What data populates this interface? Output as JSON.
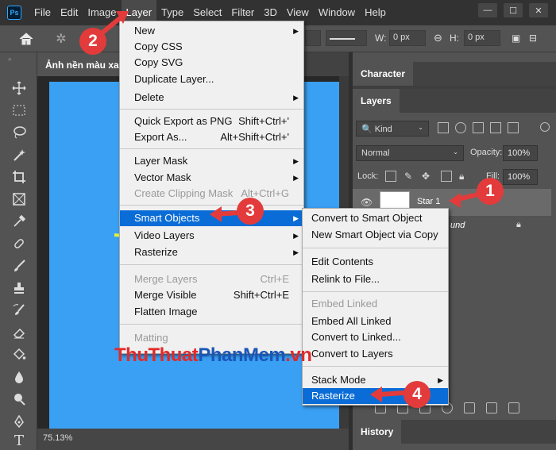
{
  "app": {
    "logo": "Ps"
  },
  "menubar": {
    "items": [
      "File",
      "Edit",
      "Image",
      "Layer",
      "Type",
      "Select",
      "Filter",
      "3D",
      "View",
      "Window",
      "Help"
    ],
    "active": "Layer"
  },
  "options_bar": {
    "w_label": "W:",
    "w_value": "0 px",
    "h_label": "H:",
    "h_value": "0 px",
    "link_icon": "link-icon"
  },
  "document": {
    "tab_title": "Ảnh nền màu xa",
    "zoom": "75.13%"
  },
  "panels": {
    "character_tab": "Character",
    "layers_tab": "Layers",
    "history_tab": "History",
    "filter_kind": "Kind",
    "blend_mode": "Normal",
    "opacity_label": "Opacity:",
    "opacity_value": "100%",
    "lock_label": "Lock:",
    "fill_label": "Fill:",
    "fill_value": "100%",
    "layers": [
      {
        "name": "Star 1",
        "selected": true
      },
      {
        "name": "und",
        "locked": true
      }
    ]
  },
  "layer_menu": {
    "items": [
      {
        "label": "New",
        "submenu": true
      },
      {
        "label": "Copy CSS"
      },
      {
        "label": "Copy SVG"
      },
      {
        "label": "Duplicate Layer..."
      },
      {
        "label": "Delete",
        "submenu": true
      },
      {
        "label": "Quick Export as PNG",
        "shortcut": "Shift+Ctrl+'"
      },
      {
        "label": "Export As...",
        "shortcut": "Alt+Shift+Ctrl+'"
      },
      {
        "label": "Layer Mask",
        "submenu": true
      },
      {
        "label": "Vector Mask",
        "submenu": true
      },
      {
        "label": "Create Clipping Mask",
        "shortcut": "Alt+Ctrl+G",
        "disabled": true
      },
      {
        "label": "Smart Objects",
        "submenu": true,
        "highlighted": true
      },
      {
        "label": "Video Layers",
        "submenu": true
      },
      {
        "label": "Rasterize",
        "submenu": true
      },
      {
        "label": "Merge Layers",
        "shortcut": "Ctrl+E",
        "disabled": true
      },
      {
        "label": "Merge Visible",
        "shortcut": "Shift+Ctrl+E"
      },
      {
        "label": "Flatten Image"
      },
      {
        "label": "Matting",
        "disabled": true
      }
    ]
  },
  "smart_objects_menu": {
    "items": [
      {
        "label": "Convert to Smart Object"
      },
      {
        "label": "New Smart Object via Copy"
      },
      {
        "label": "Edit Contents"
      },
      {
        "label": "Relink to File..."
      },
      {
        "label": "Embed Linked",
        "disabled": true
      },
      {
        "label": "Embed All Linked"
      },
      {
        "label": "Convert to Linked..."
      },
      {
        "label": "Convert to Layers"
      },
      {
        "label": "Stack Mode",
        "submenu": true
      },
      {
        "label": "Rasterize",
        "highlighted": true
      }
    ]
  },
  "callouts": [
    "1",
    "2",
    "3",
    "4"
  ],
  "watermark": {
    "part1": "ThuThuat",
    "part2": "PhanMem",
    "part3": ".vn"
  },
  "colors": {
    "highlight": "#0a6cd6",
    "callout": "#e33b3b",
    "canvas": "#3aa0f3"
  }
}
